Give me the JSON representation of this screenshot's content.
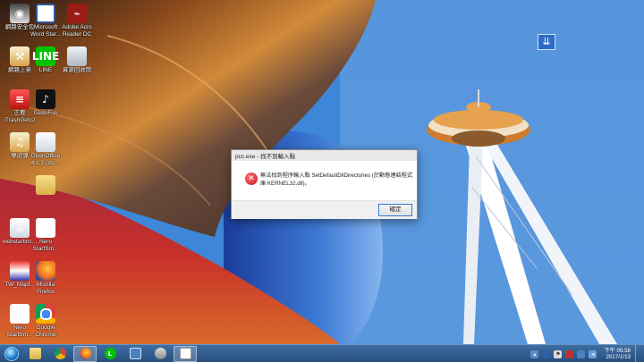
{
  "desktop": {
    "icons": [
      {
        "label": "網路安全包",
        "icon": "security-app-icon"
      },
      {
        "label": "Microsoft\nWord Star...",
        "icon": "word-icon"
      },
      {
        "label": "Adobe Acro\nReader DC",
        "icon": "pdf-icon"
      },
      {
        "label": "網路上票",
        "icon": "tools-icon"
      },
      {
        "label": "LINE",
        "icon": "line-icon"
      },
      {
        "label": "資源回收筒",
        "icon": "recycle-bin-icon"
      },
      {
        "label": "正要\niTrashGetc2",
        "icon": "trash-app-icon"
      },
      {
        "label": "GeanFun",
        "icon": "beanfun-icon"
      },
      {
        "label": "樂欲導",
        "icon": "music-app-icon"
      },
      {
        "label": "OpenOffice\n4.1.2 (zh-...",
        "icon": "openoffice-icon"
      },
      {
        "label": "",
        "icon": "folder-icon"
      },
      {
        "label": "webstartinc...",
        "icon": "webstart-icon"
      },
      {
        "label": "Nero\nStartSm...",
        "icon": "nero-icon"
      },
      {
        "label": "TW_MapI...",
        "icon": "tw-map-icon"
      },
      {
        "label": "Mozilla\nFirefox",
        "icon": "firefox-icon"
      },
      {
        "label": "Nero\nStartSm...",
        "icon": "nero-icon"
      },
      {
        "label": "Google\nChrome",
        "icon": "chrome-icon"
      }
    ]
  },
  "dialog": {
    "title": "pcc.exe - 找不到輸入點",
    "message": "無法找到程序輸入點 SetDefaultDllDirectories (於動態連結程式庫 KERNEL32.dll)。",
    "ok_label": "確定"
  },
  "taskbar": {
    "pinned": [
      "explorer-icon",
      "chrome-icon",
      "firefox-icon",
      "line-icon",
      "network-icon",
      "tools-icon",
      "window-icon"
    ],
    "clock_time": "下午 05:58",
    "clock_date": "2017/1/13"
  },
  "colors": {
    "taskbar": "#2f5d8e",
    "dialog_ok_border": "#2f7bd6",
    "error_red": "#c81c1c"
  }
}
